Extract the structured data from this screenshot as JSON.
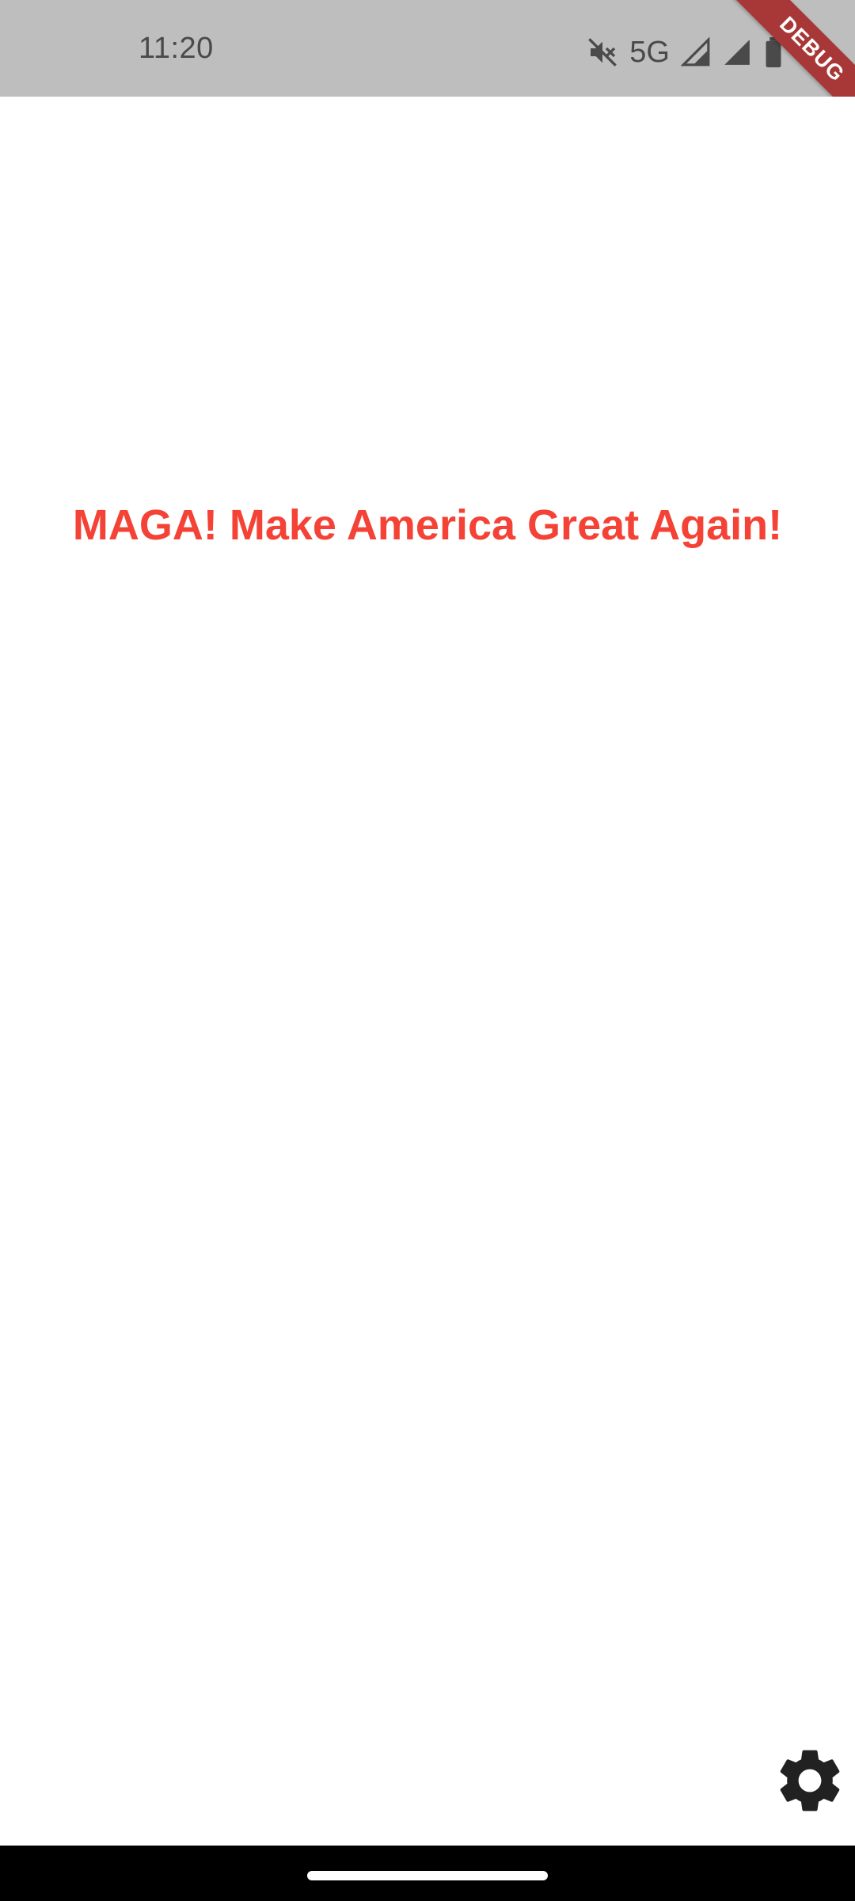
{
  "status_bar": {
    "time": "11:20",
    "network": "5G",
    "icons": [
      "mute-icon",
      "signal-icon",
      "signal-icon",
      "battery-icon"
    ],
    "background_color": "#bebebe"
  },
  "debug_banner": {
    "label": "DEBUG",
    "color": "#a83838"
  },
  "main": {
    "headline": "MAGA! Make America Great Again!",
    "headline_color": "#f44336"
  },
  "settings_button": {
    "icon": "gear-icon"
  },
  "nav_bar": {
    "handle": "home-handle"
  }
}
